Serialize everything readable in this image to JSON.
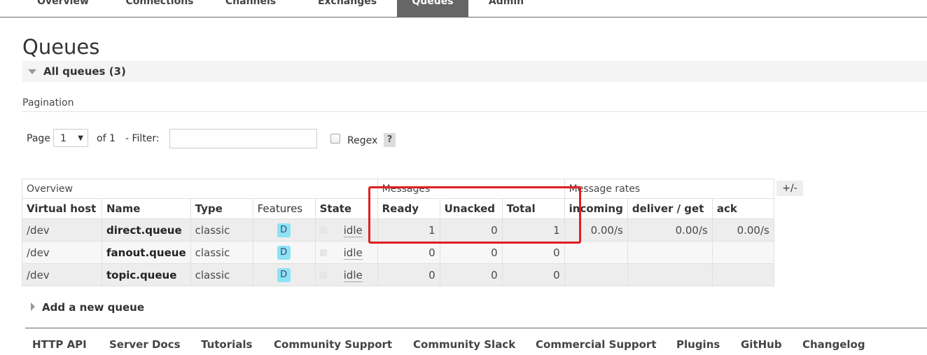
{
  "nav": {
    "tabs": [
      "Overview",
      "Connections",
      "Channels",
      "Exchanges",
      "Queues",
      "Admin"
    ],
    "active": "Queues"
  },
  "page_title": "Queues",
  "section": {
    "label": "All queues (3)"
  },
  "pagination": {
    "label": "Pagination",
    "page_label": "Page",
    "page_value": "1",
    "of_label": "of 1",
    "filter_label": "- Filter:",
    "filter_value": "",
    "regex_label": "Regex",
    "help_label": "?"
  },
  "table": {
    "groups": {
      "overview": "Overview",
      "messages": "Messages",
      "rates": "Message rates"
    },
    "columns": {
      "vhost": "Virtual host",
      "name": "Name",
      "type": "Type",
      "features": "Features",
      "state": "State",
      "ready": "Ready",
      "unacked": "Unacked",
      "total": "Total",
      "incoming": "incoming",
      "deliver": "deliver / get",
      "ack": "ack"
    },
    "rows": [
      {
        "vhost": "/dev",
        "name": "direct.queue",
        "type": "classic",
        "feature": "D",
        "state": "idle",
        "ready": "1",
        "unacked": "0",
        "total": "1",
        "incoming": "0.00/s",
        "deliver": "0.00/s",
        "ack": "0.00/s"
      },
      {
        "vhost": "/dev",
        "name": "fanout.queue",
        "type": "classic",
        "feature": "D",
        "state": "idle",
        "ready": "0",
        "unacked": "0",
        "total": "0",
        "incoming": "",
        "deliver": "",
        "ack": ""
      },
      {
        "vhost": "/dev",
        "name": "topic.queue",
        "type": "classic",
        "feature": "D",
        "state": "idle",
        "ready": "0",
        "unacked": "0",
        "total": "0",
        "incoming": "",
        "deliver": "",
        "ack": ""
      }
    ],
    "toggle_label": "+/-"
  },
  "add_queue": "Add a new queue",
  "footer": {
    "links": [
      "HTTP API",
      "Server Docs",
      "Tutorials",
      "Community Support",
      "Community Slack",
      "Commercial Support",
      "Plugins",
      "GitHub",
      "Changelog"
    ]
  },
  "colors": {
    "highlight": "#e02020",
    "feature_badge": "#8be3f5",
    "active_tab": "#666666"
  }
}
